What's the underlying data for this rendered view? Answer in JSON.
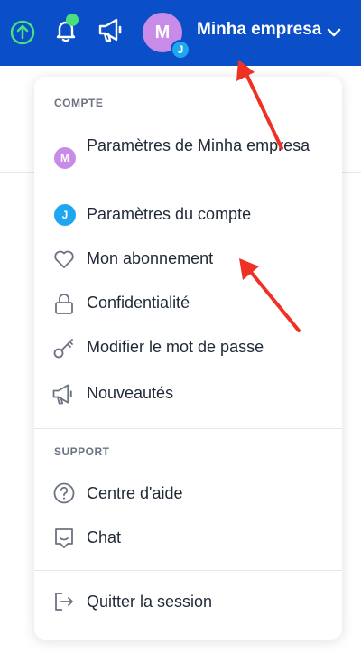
{
  "header": {
    "company_name": "Minha empresa",
    "avatar_letter": "M",
    "avatar_badge_letter": "J",
    "notification_dot_color": "#4ade80",
    "brand_color": "#0a4fc7"
  },
  "menu": {
    "account_section_title": "COMPTE",
    "account_items": [
      {
        "label": "Paramètres de Minha empresa",
        "icon": "avatar-m",
        "color": "#c88be8",
        "letter": "M"
      },
      {
        "label": "Paramètres du compte",
        "icon": "avatar-j",
        "color": "#1ea7f0",
        "letter": "J"
      },
      {
        "label": "Mon abonnement",
        "icon": "heart-icon"
      },
      {
        "label": "Confidentialité",
        "icon": "lock-icon"
      },
      {
        "label": "Modifier le mot de passe",
        "icon": "key-icon"
      },
      {
        "label": "Nouveautés",
        "icon": "megaphone-icon"
      }
    ],
    "support_section_title": "SUPPORT",
    "support_items": [
      {
        "label": "Centre d'aide",
        "icon": "help-icon"
      },
      {
        "label": "Chat",
        "icon": "chat-icon"
      }
    ],
    "logout_label": "Quitter la session"
  }
}
